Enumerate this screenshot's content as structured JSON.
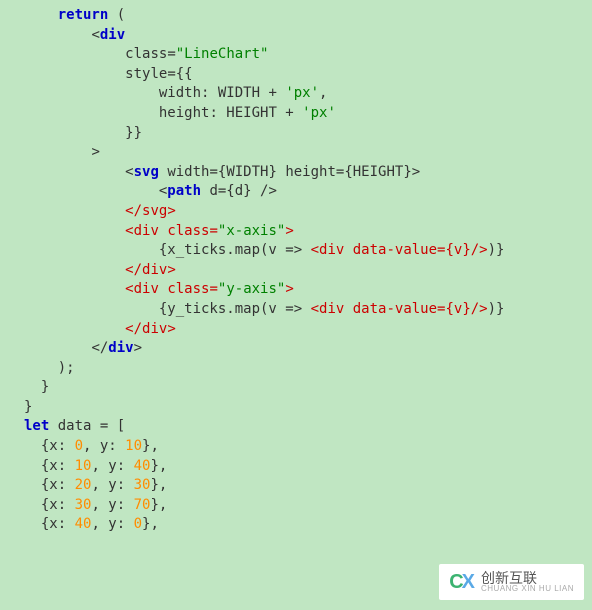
{
  "code": {
    "l1": {
      "kw": "return",
      "p": " ("
    },
    "l2": {
      "t": "<",
      "tag": "div"
    },
    "l3": {
      "attr": "class",
      "eq": "=",
      "val": "\"LineChart\""
    },
    "l4": {
      "attr": "style",
      "eq": "=",
      "b": "{{"
    },
    "l5": {
      "k": "width",
      "c": ": ",
      "v": "WIDTH",
      "plus": " + ",
      "s": "'px'",
      "end": ","
    },
    "l6": {
      "k": "height",
      "c": ": ",
      "v": "HEIGHT",
      "plus": " + ",
      "s": "'px'"
    },
    "l7": {
      "b": "}}"
    },
    "l8": {
      "gt": ">"
    },
    "l9": {
      "o": "<",
      "tag": "svg",
      "mid": " width={WIDTH} height={HEIGHT}",
      "c": ">"
    },
    "l10": {
      "o": "<",
      "tag": "path",
      "mid": " d={d} /",
      "c": ">"
    },
    "l11": {
      "o": "</",
      "tag": "svg",
      "c": ">"
    },
    "l12": {
      "o": "<",
      "tag": "div",
      "mid": " class=",
      "val": "\"x-axis\"",
      "c": ">"
    },
    "l13_a": "{x_ticks.map(v => ",
    "l13_b": "<",
    "l13_tag": "div",
    "l13_c": " data-value={v}/",
    "l13_d": ">",
    "l13_e": ")}",
    "l14": {
      "o": "</",
      "tag": "div",
      "c": ">"
    },
    "l15": {
      "o": "<",
      "tag": "div",
      "mid": " class=",
      "val": "\"y-axis\"",
      "c": ">"
    },
    "l16_a": "{y_ticks.map(v => ",
    "l16_b": "<",
    "l16_tag": "div",
    "l16_c": " data-value={v}/",
    "l16_d": ">",
    "l16_e": ")}",
    "l17": {
      "o": "</",
      "tag": "div",
      "c": ">"
    },
    "l18": {
      "o": "</",
      "tag": "div",
      "c": ">"
    },
    "l19": ");",
    "l20": "}",
    "l21": "}",
    "l22_kw": "let",
    "l22_rest": " data = [",
    "d0": {
      "x": "0",
      "y": "10"
    },
    "d1": {
      "x": "10",
      "y": "40"
    },
    "d2": {
      "x": "20",
      "y": "30"
    },
    "d3": {
      "x": "30",
      "y": "70"
    },
    "d4": {
      "x": "40",
      "y": "0"
    }
  },
  "watermark": {
    "cn": "创新互联",
    "en": "CHUANG XIN HU LIAN"
  }
}
